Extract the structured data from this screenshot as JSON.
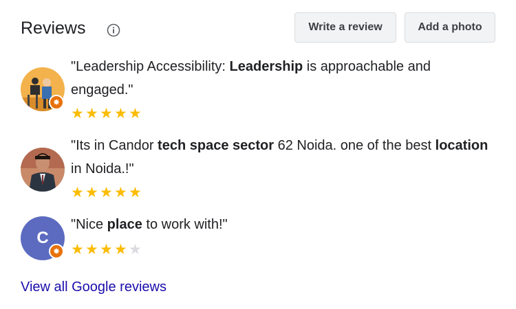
{
  "header": {
    "title": "Reviews",
    "write_review_label": "Write a review",
    "add_photo_label": "Add a photo"
  },
  "reviews": [
    {
      "segments": [
        "\"Leadership Accessibility: ",
        "Leadership",
        " is approachable and engaged.\""
      ],
      "rating": 5,
      "avatar": "photo",
      "badge": true
    },
    {
      "segments": [
        "\"Its in Candor ",
        "tech space sector",
        " 62 Noida. one of the best ",
        "location",
        " in Noida.!\""
      ],
      "rating": 5,
      "avatar": "photo",
      "badge": false
    },
    {
      "segments": [
        "\"Nice ",
        "place",
        " to work with!\""
      ],
      "rating": 4,
      "avatar_letter": "C",
      "badge": true
    }
  ],
  "view_all_label": "View all Google reviews",
  "colors": {
    "star": "#fbbc04",
    "star_empty": "#dadce0",
    "link": "#1a0dab",
    "letter_avatar": "#5c6bc0",
    "badge": "#e8710a"
  },
  "icons": [
    "info-icon",
    "star-icon",
    "local-guide-badge-icon"
  ]
}
